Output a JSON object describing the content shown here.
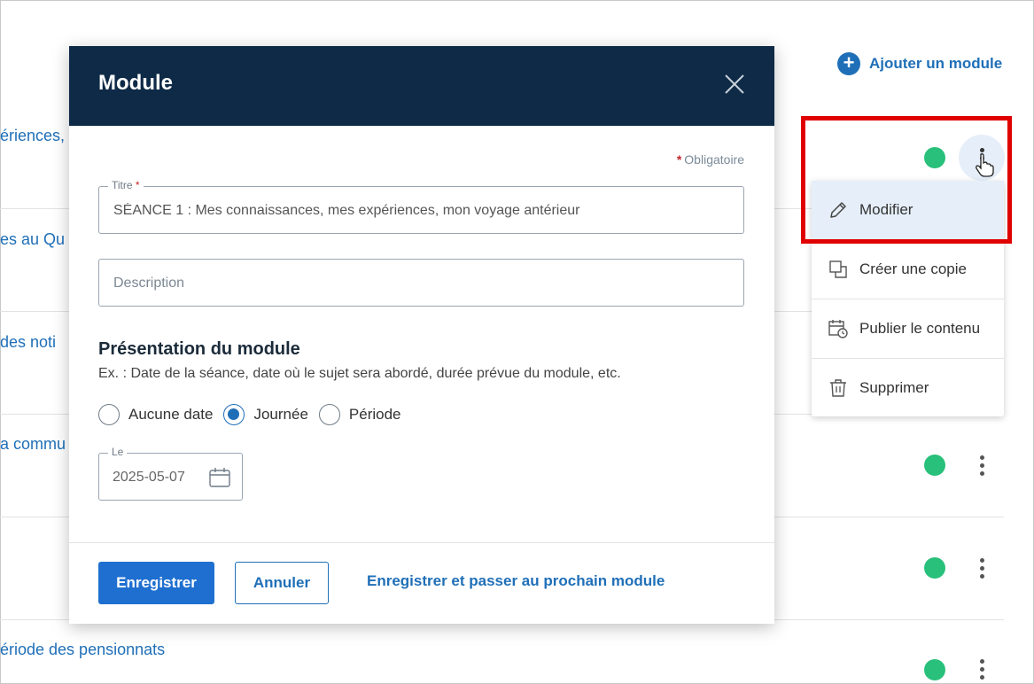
{
  "header": {
    "add_module_label": "Ajouter un module"
  },
  "background_rows": [
    {
      "text": "ériences,"
    },
    {
      "text": "es au Qu"
    },
    {
      "text": " des noti"
    },
    {
      "text": "a commu"
    },
    {
      "text": "ériode des pensionnats"
    }
  ],
  "context_menu": {
    "items": [
      {
        "label": "Modifier",
        "icon": "pencil-icon"
      },
      {
        "label": "Créer une copie",
        "icon": "copy-icon"
      },
      {
        "label": "Publier le contenu",
        "icon": "schedule-icon"
      },
      {
        "label": "Supprimer",
        "icon": "trash-icon"
      }
    ]
  },
  "modal": {
    "title": "Module",
    "required_note": "Obligatoire",
    "title_field": {
      "label": "Titre",
      "value": "SÉANCE 1 : Mes connaissances, mes expériences, mon voyage antérieur"
    },
    "description_field": {
      "placeholder": "Description"
    },
    "presentation": {
      "title": "Présentation du module",
      "help": "Ex. : Date de la séance, date où le sujet sera abordé, durée prévue du module, etc.",
      "options": [
        {
          "label": "Aucune date",
          "selected": false
        },
        {
          "label": "Journée",
          "selected": true
        },
        {
          "label": "Période",
          "selected": false
        }
      ],
      "date_label": "Le",
      "date_value": "2025-05-07"
    },
    "footer": {
      "save_label": "Enregistrer",
      "cancel_label": "Annuler",
      "save_next_label": "Enregistrer et passer au prochain module"
    }
  },
  "colors": {
    "accent": "#1f6fb8",
    "header_bg": "#0e2a47",
    "status_green": "#28c07a",
    "highlight_red": "#e00000"
  }
}
